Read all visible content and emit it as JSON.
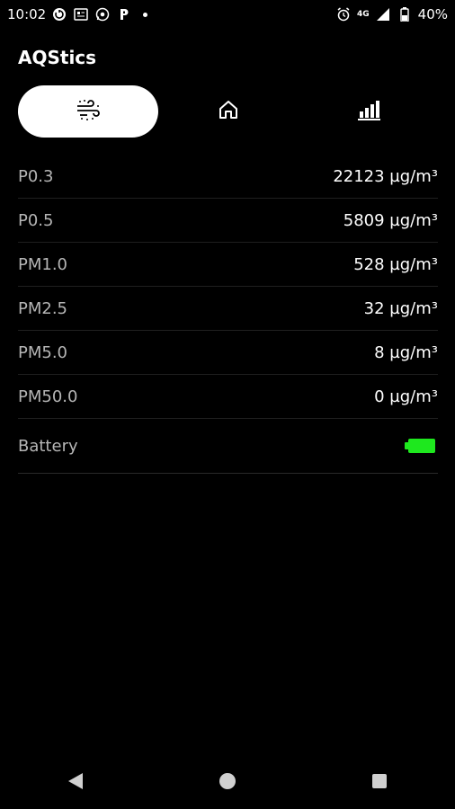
{
  "status_bar": {
    "time": "10:02",
    "network": "4G",
    "battery_percent": "40%",
    "icons_left": [
      "sync-icon",
      "news-icon",
      "whatsapp-icon",
      "paytm-icon",
      "notification-dot"
    ],
    "icons_right": [
      "alarm-icon",
      "signal-icon",
      "battery-icon"
    ]
  },
  "app": {
    "title": "AQStics"
  },
  "tabs": [
    {
      "name": "air",
      "icon": "wind-icon",
      "active": true
    },
    {
      "name": "home",
      "icon": "home-icon",
      "active": false
    },
    {
      "name": "stats",
      "icon": "bar-chart-icon",
      "active": false
    }
  ],
  "readings": [
    {
      "label": "P0.3",
      "value": "22123 µg/m³"
    },
    {
      "label": "P0.5",
      "value": "5809 µg/m³"
    },
    {
      "label": "PM1.0",
      "value": "528 µg/m³"
    },
    {
      "label": "PM2.5",
      "value": "32 µg/m³"
    },
    {
      "label": "PM5.0",
      "value": "8 µg/m³"
    },
    {
      "label": "PM50.0",
      "value": "0 µg/m³"
    }
  ],
  "battery": {
    "label": "Battery",
    "color": "#1ee81e"
  },
  "nav": [
    "back-icon",
    "home-icon",
    "recents-icon"
  ],
  "colors": {
    "background": "#000000",
    "active_tab": "#ffffff",
    "label_text": "#b5b5b5"
  }
}
